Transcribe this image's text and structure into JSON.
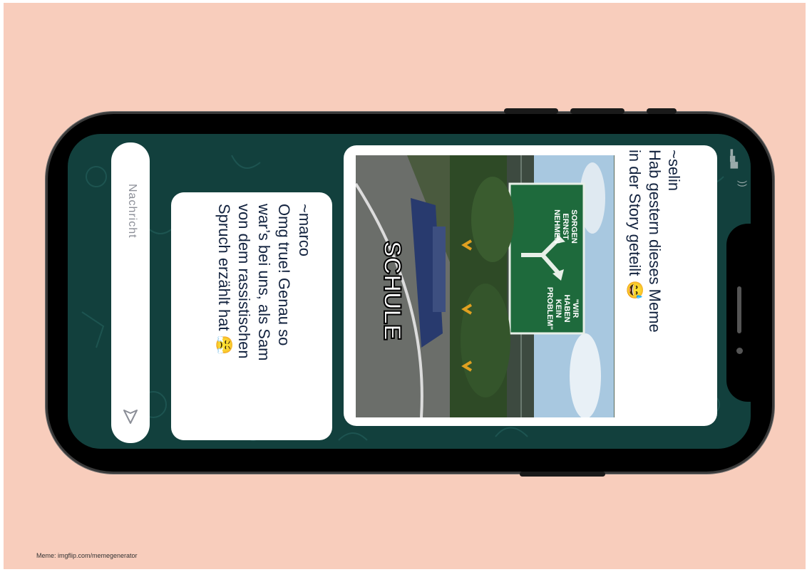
{
  "credit": "Meme: imgflip.com/memegenerator",
  "chat": {
    "messages": [
      {
        "sender": "~selin",
        "lines": [
          "Hab gestern dieses Meme",
          "in der Story geteilt"
        ],
        "emoji": "😅",
        "meme": {
          "sign_left": [
            "SORGEN",
            "ERNST",
            "NEHMEN"
          ],
          "sign_right": [
            "\"WIR",
            "HABEN",
            "KEIN",
            "PROBLEM\""
          ],
          "car_label": "SCHULE"
        }
      },
      {
        "sender": "~marco",
        "lines": [
          "Omg true! Genau so",
          "war’s bei uns, als Sam",
          "von dem rassistischen",
          "Spruch erzählt hat"
        ],
        "emoji": "😤"
      }
    ],
    "input": {
      "placeholder": "Nachricht",
      "send_icon": "send-icon"
    }
  },
  "colors": {
    "background": "#f8cdbc",
    "chat_wallpaper": "#12403d",
    "text": "#13233f"
  }
}
